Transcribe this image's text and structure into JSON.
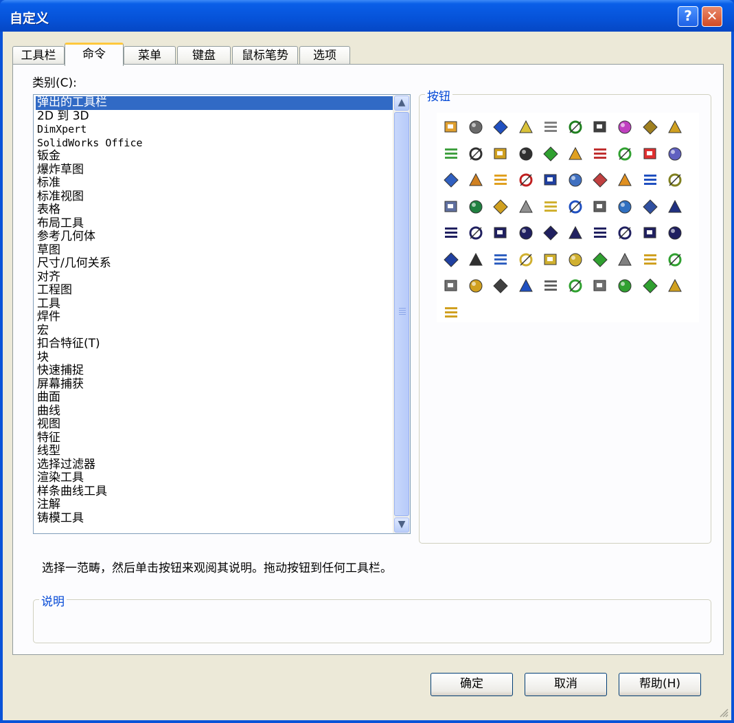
{
  "window": {
    "title": "自定义",
    "help_glyph": "?",
    "close_glyph": "✕"
  },
  "tabs": [
    "工具栏",
    "命令",
    "菜单",
    "键盘",
    "鼠标笔势",
    "选项"
  ],
  "active_tab": "命令",
  "category_label": "类别(C):",
  "categories": [
    "弹出的工具栏",
    "2D 到 3D",
    "DimXpert",
    "SolidWorks Office",
    "钣金",
    "爆炸草图",
    "标准",
    "标准视图",
    "表格",
    "布局工具",
    "参考几何体",
    "草图",
    "尺寸/几何关系",
    "对齐",
    "工程图",
    "工具",
    "焊件",
    "宏",
    "扣合特征(T)",
    "块",
    "快速捕捉",
    "屏幕捕获",
    "曲面",
    "曲线",
    "视图",
    "特征",
    "线型",
    "选择过滤器",
    "渲染工具",
    "样条曲线工具",
    "注解",
    "铸模工具"
  ],
  "selected_category": "弹出的工具栏",
  "buttons_group_label": "按钮",
  "hint_text": "选择一范畴，然后单击按钮来观阅其说明。拖动按钮到任何工具栏。",
  "description_group_label": "说明",
  "buttons": {
    "ok": "确定",
    "cancel": "取消",
    "help": "帮助(H)"
  },
  "icons": [
    {
      "name": "sketch-entities-icon",
      "color": "#e0a030"
    },
    {
      "name": "dimension-icon",
      "color": "#6a6a6a"
    },
    {
      "name": "annotation-icon",
      "color": "#2050c0"
    },
    {
      "name": "solid-cube-icon",
      "color": "#d9c23a"
    },
    {
      "name": "note-icon",
      "color": "#808080"
    },
    {
      "name": "curve-icon",
      "color": "#208020"
    },
    {
      "name": "stairs-icon",
      "color": "#404040"
    },
    {
      "name": "crosshair-icon",
      "color": "#c040c0"
    },
    {
      "name": "layout-icon",
      "color": "#a08020"
    },
    {
      "name": "weldment-icon",
      "color": "#d0a020"
    },
    {
      "name": "surface-icon",
      "color": "#40a040"
    },
    {
      "name": "bold-italic-icon",
      "color": "#303030"
    },
    {
      "name": "table-frame-icon",
      "color": "#d0a020"
    },
    {
      "name": "line-format-icon",
      "color": "#303030"
    },
    {
      "name": "color-bars-icon",
      "color": "#30a030"
    },
    {
      "name": "feature-box-icon",
      "color": "#e0a020"
    },
    {
      "name": "circle-target-icon",
      "color": "#c03030"
    },
    {
      "name": "sparkle-icon",
      "color": "#30a030"
    },
    {
      "name": "color-wheel-icon",
      "color": "#e03030"
    },
    {
      "name": "palette-icon",
      "color": "#6060c0"
    },
    {
      "name": "select-filter-icon",
      "color": "#3060c0"
    },
    {
      "name": "gear-box-icon",
      "color": "#d08020"
    },
    {
      "name": "dimension-tool-icon",
      "color": "#e0a020"
    },
    {
      "name": "solidworks-logo-icon",
      "color": "#c02020"
    },
    {
      "name": "swept-icon",
      "color": "#2040a0"
    },
    {
      "name": "document-stack-icon",
      "color": "#4070c0"
    },
    {
      "name": "box-view-icon",
      "color": "#c04040"
    },
    {
      "name": "diamond-icon",
      "color": "#e09020"
    },
    {
      "name": "table-icon",
      "color": "#2050c0"
    },
    {
      "name": "sum-icon",
      "color": "#808020"
    },
    {
      "name": "part-icon",
      "color": "#6070a0"
    },
    {
      "name": "globe-icon",
      "color": "#208040"
    },
    {
      "name": "chart-icon",
      "color": "#d0a020"
    },
    {
      "name": "new-document-icon",
      "color": "#909090"
    },
    {
      "name": "open-folder-icon",
      "color": "#d0b030"
    },
    {
      "name": "save-icon",
      "color": "#2050c0"
    },
    {
      "name": "print-icon",
      "color": "#606060"
    },
    {
      "name": "list-icon",
      "color": "#3070c0"
    },
    {
      "name": "edit-sketch-icon",
      "color": "#3050a0"
    },
    {
      "name": "line-icon",
      "color": "#203080"
    },
    {
      "name": "rectangle-icon",
      "color": "#202060"
    },
    {
      "name": "slot-icon",
      "color": "#202060"
    },
    {
      "name": "circle-icon",
      "color": "#202060"
    },
    {
      "name": "arc-icon",
      "color": "#202060"
    },
    {
      "name": "ellipse-icon",
      "color": "#202060"
    },
    {
      "name": "spline-icon",
      "color": "#202060"
    },
    {
      "name": "fillet-icon",
      "color": "#202060"
    },
    {
      "name": "plane-icon",
      "color": "#202060"
    },
    {
      "name": "mirror-icon",
      "color": "#202060"
    },
    {
      "name": "snap-icon",
      "color": "#202060"
    },
    {
      "name": "grid-pattern-icon",
      "color": "#2040a0"
    },
    {
      "name": "underline-icon",
      "color": "#303030"
    },
    {
      "name": "tag-icon",
      "color": "#3060c0"
    },
    {
      "name": "extrude-icon",
      "color": "#d0b030"
    },
    {
      "name": "cut-icon",
      "color": "#d0b030"
    },
    {
      "name": "shell-icon",
      "color": "#d0b030"
    },
    {
      "name": "pattern-icon",
      "color": "#30a030"
    },
    {
      "name": "shapes-icon",
      "color": "#808080"
    },
    {
      "name": "folder-move-icon",
      "color": "#d0a020"
    },
    {
      "name": "distribute-icon",
      "color": "#30a030"
    },
    {
      "name": "rotate-view-icon",
      "color": "#707070"
    },
    {
      "name": "assembly-icon",
      "color": "#d0a020"
    },
    {
      "name": "swap-icon",
      "color": "#404040"
    },
    {
      "name": "text-style-icon",
      "color": "#2050c0"
    },
    {
      "name": "monitor-icon",
      "color": "#606060"
    },
    {
      "name": "check-cross-icon",
      "color": "#30a030"
    },
    {
      "name": "key-icon",
      "color": "#707070"
    },
    {
      "name": "block-icon",
      "color": "#30a030"
    },
    {
      "name": "align-icon",
      "color": "#30a030"
    },
    {
      "name": "coins-icon",
      "color": "#d0a020"
    },
    {
      "name": "mold-tool-icon",
      "color": "#d0a020"
    }
  ]
}
